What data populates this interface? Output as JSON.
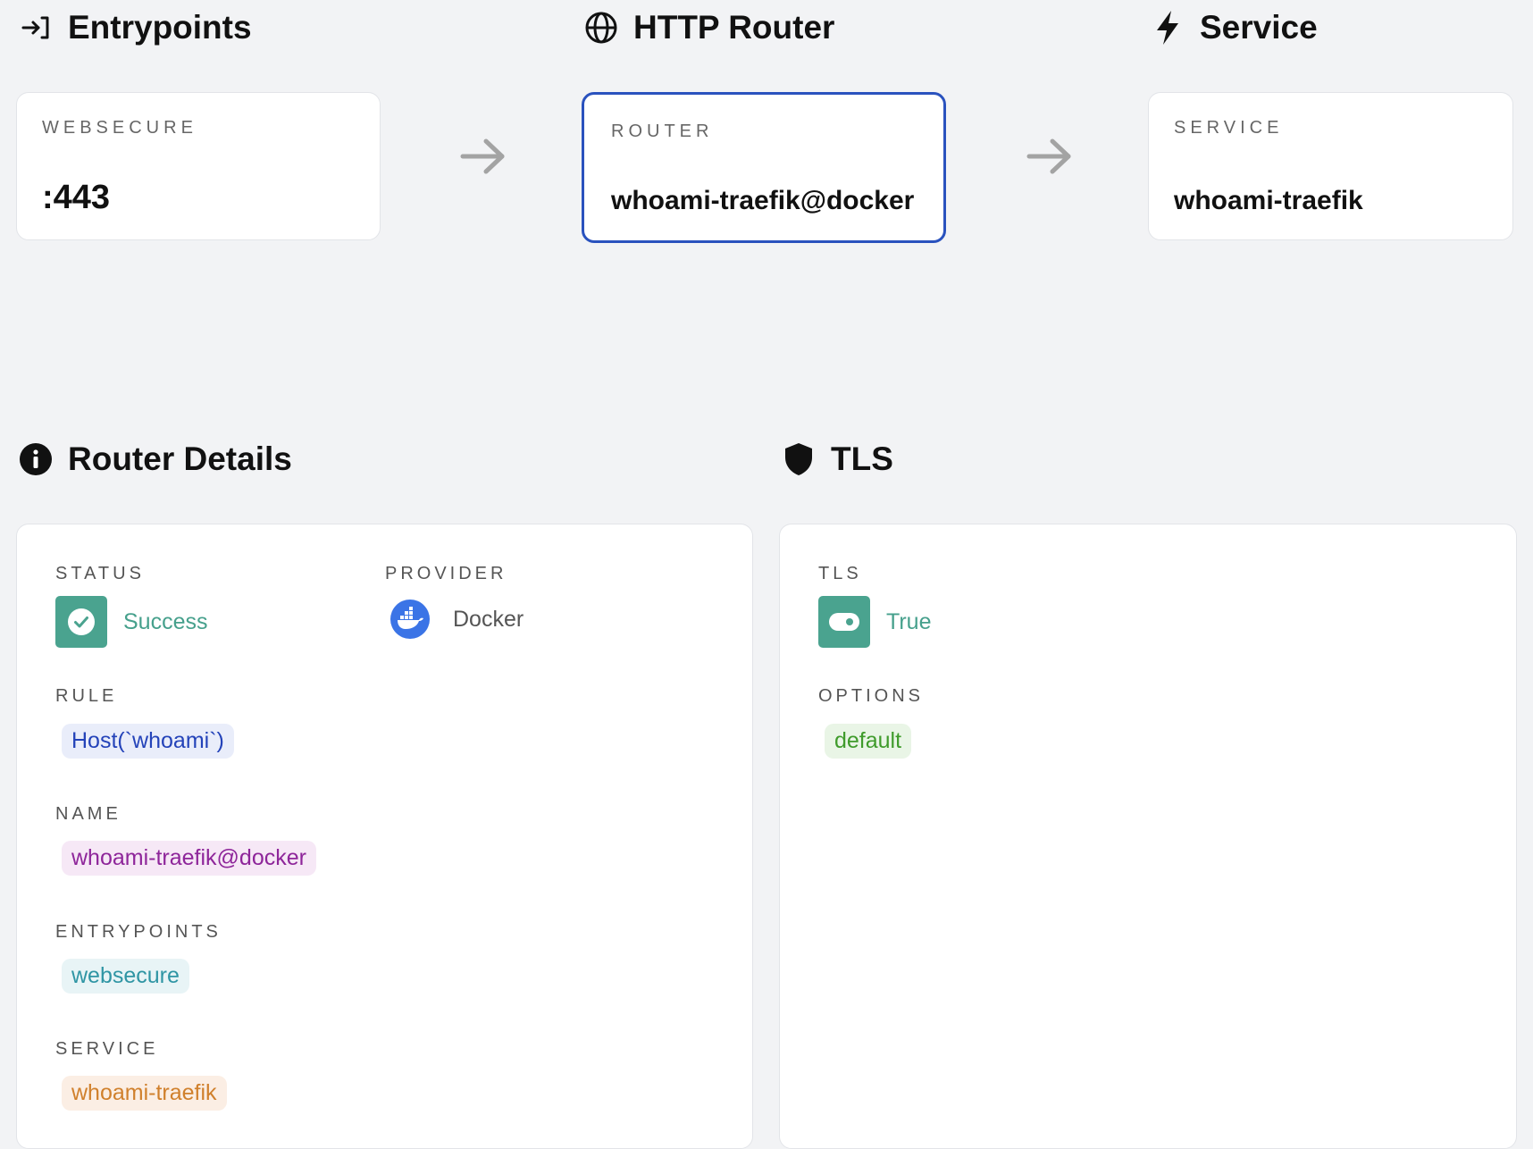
{
  "flow": {
    "entrypoints": {
      "heading": "Entrypoints",
      "label": "WEBSECURE",
      "value": ":443"
    },
    "router": {
      "heading": "HTTP Router",
      "label": "ROUTER",
      "value": "whoami-traefik@docker"
    },
    "service": {
      "heading": "Service",
      "label": "SERVICE",
      "value": "whoami-traefik"
    }
  },
  "router_details": {
    "heading": "Router Details",
    "status_label": "STATUS",
    "status_value": "Success",
    "provider_label": "PROVIDER",
    "provider_value": "Docker",
    "rule_label": "RULE",
    "rule_value": "Host(`whoami`)",
    "name_label": "NAME",
    "name_value": "whoami-traefik@docker",
    "entrypoints_label": "ENTRYPOINTS",
    "entrypoints_value": "websecure",
    "service_label": "SERVICE",
    "service_value": "whoami-traefik"
  },
  "tls": {
    "heading": "TLS",
    "tls_label": "TLS",
    "tls_value": "True",
    "options_label": "OPTIONS",
    "options_value": "default"
  },
  "colors": {
    "accent_border": "#2a52be",
    "success": "#4aa38f",
    "docker_blue": "#3b74e6"
  },
  "icons": {
    "entrypoints": "sign-in-icon",
    "router": "globe-icon",
    "service": "lightning-icon",
    "details": "info-icon",
    "tls": "shield-icon"
  }
}
